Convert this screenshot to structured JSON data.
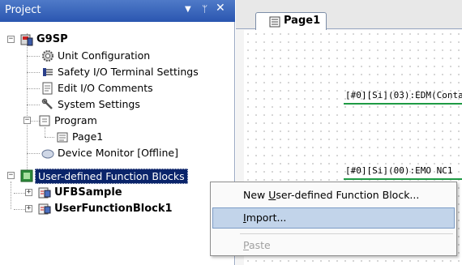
{
  "project_panel": {
    "title": "Project",
    "root": "G9SP",
    "items": {
      "unit_configuration": "Unit Configuration",
      "safety_io": "Safety I/O Terminal Settings",
      "edit_io_comments": "Edit I/O Comments",
      "system_settings": "System Settings",
      "program": "Program",
      "page1": "Page1",
      "device_monitor": "Device Monitor [Offline]",
      "ufb": "User-defined Function Blocks",
      "ufb_sample": "UFBSample",
      "user_function_block1": "UserFunctionBlock1"
    }
  },
  "document": {
    "tab_label": "Page1",
    "tag1": "[#0][Si](03):EDM(Conta",
    "tag2": "[#0][Si](00):EMO NC1"
  },
  "context_menu": {
    "new_ufb": {
      "prefix": "New ",
      "accel": "U",
      "rest": "ser-defined Function Block..."
    },
    "import": {
      "prefix": "",
      "accel": "I",
      "rest": "mport..."
    },
    "paste": {
      "prefix": "",
      "accel": "P",
      "rest": "aste"
    }
  },
  "colors": {
    "header": "#2a56b0",
    "selection": "#0a246a",
    "menu_highlight": "#c2d4ea",
    "ladder_line": "#1e9a44"
  }
}
